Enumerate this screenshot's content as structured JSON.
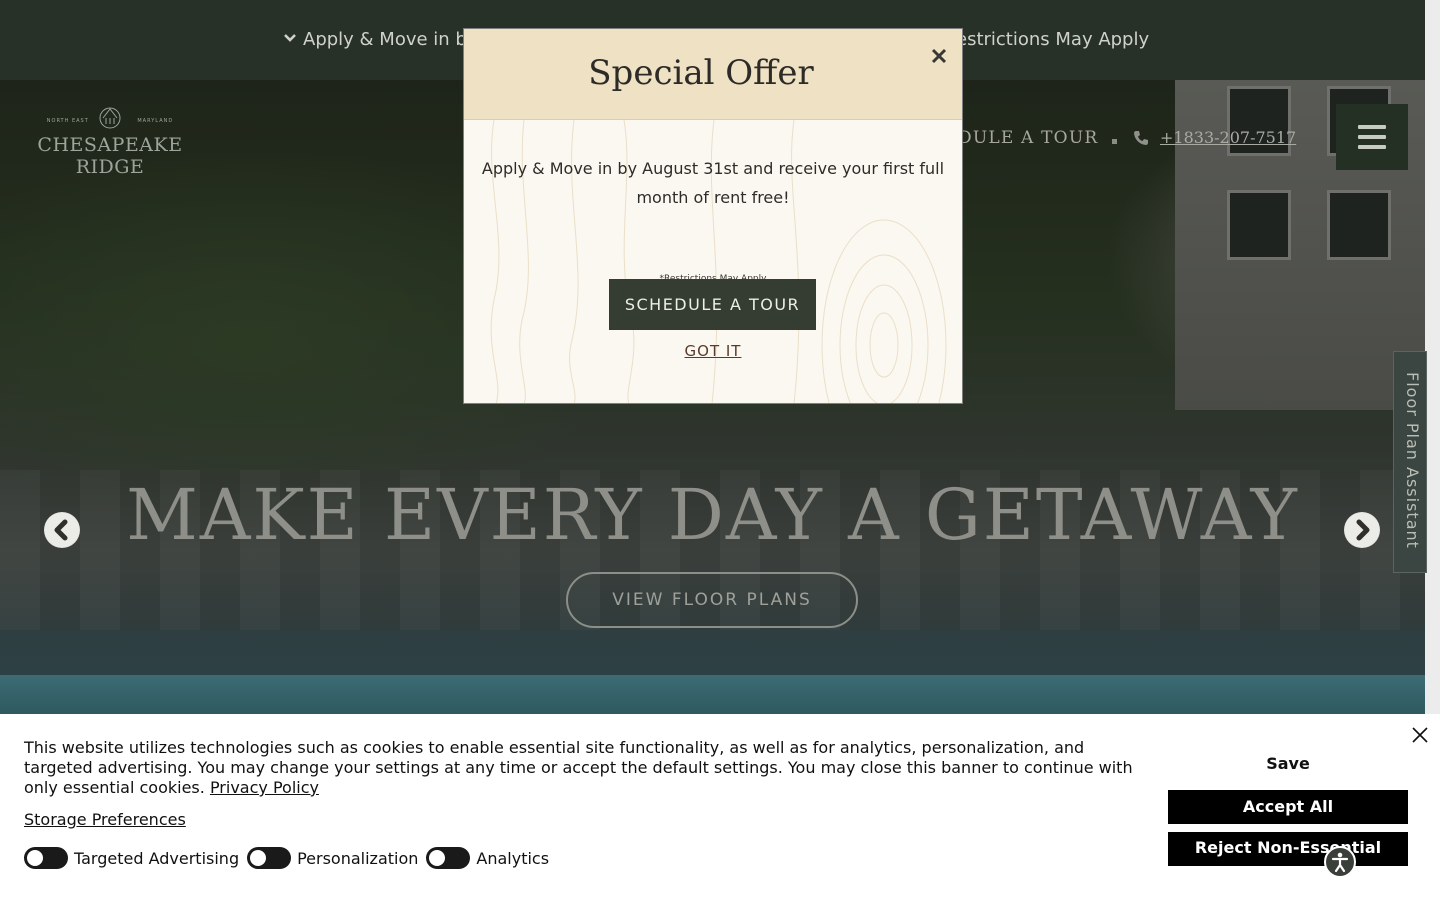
{
  "announcement": {
    "left_text": "Apply & Move in by",
    "right_text": "estrictions May Apply"
  },
  "logo": {
    "small_left": "NORTH EAST",
    "small_right": "MARYLAND",
    "line1": "CHESAPEAKE",
    "line2": "RIDGE"
  },
  "nav": {
    "tour_partial": "DULE A TOUR",
    "phone": "+1833-207-7517",
    "menu_icon": "hamburger-icon"
  },
  "floor_tab": {
    "label": "Floor Plan Assistant"
  },
  "hero": {
    "headline": "MAKE EVERY DAY A GETAWAY",
    "cta": "VIEW FLOOR PLANS"
  },
  "modal": {
    "title": "Special Offer",
    "body": "Apply & Move in by August 31st and receive your first full month of rent free!",
    "fine_print": "*Restrictions May Apply",
    "cta": "SCHEDULE A TOUR",
    "dismiss": "GOT IT"
  },
  "cookie": {
    "text": "This website utilizes technologies such as cookies to enable essential site functionality, as well as for analytics, personalization, and targeted advertising. You may change your settings at any time or accept the default settings. You may close this banner to continue with only essential cookies.",
    "privacy_link": "Privacy Policy",
    "storage_link": "Storage Preferences",
    "toggles": [
      {
        "label": "Targeted Advertising",
        "on": false
      },
      {
        "label": "Personalization",
        "on": false
      },
      {
        "label": "Analytics",
        "on": false
      }
    ],
    "save": "Save",
    "accept": "Accept All",
    "reject": "Reject Non-Essential"
  },
  "colors": {
    "topbar": "#283127",
    "modal_header": "#efe1c4",
    "modal_cta": "#353d33",
    "menu_button": "#253025"
  }
}
